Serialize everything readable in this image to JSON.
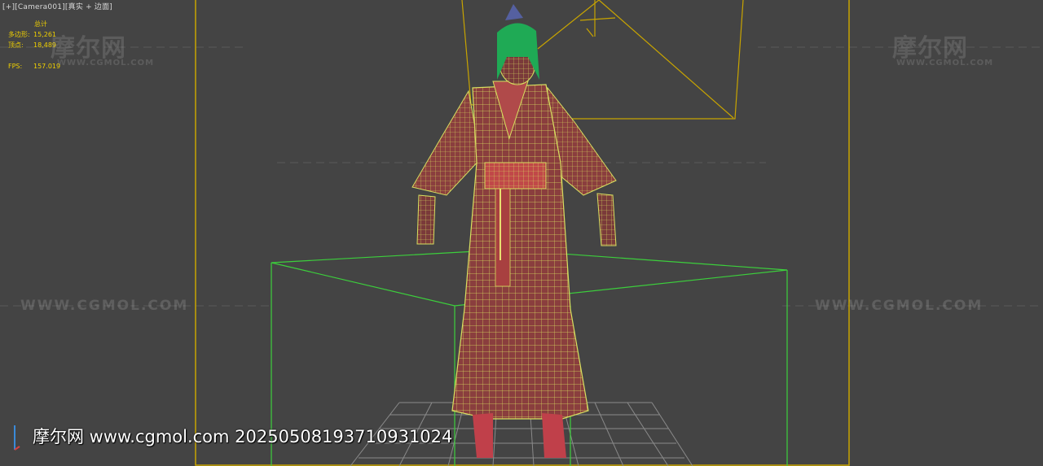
{
  "viewport": {
    "label_parts": [
      "[+]",
      "[Camera001]",
      "[真实 + 边面]"
    ],
    "background_color": "#444444",
    "safe_frame_color": "#c8a400",
    "wireframe_color": "#d8e060",
    "bounding_box_color": "#3ccf3c"
  },
  "stats": {
    "header": "总计",
    "rows": [
      {
        "label": "多边形:",
        "value": "15,261"
      },
      {
        "label": "顶点:",
        "value": "18,489"
      },
      {
        "label": "FPS:",
        "value": "157.019"
      }
    ],
    "color": "#f0d000"
  },
  "watermarks": {
    "logo": "摩尔网",
    "sub": "WWW.CGMOL.COM",
    "url": "WWW.CGMOL.COM"
  },
  "credit": {
    "text": "摩尔网 www.cgmol.com 20250508193710931024"
  },
  "icons": [
    "axis-gizmo-icon"
  ]
}
